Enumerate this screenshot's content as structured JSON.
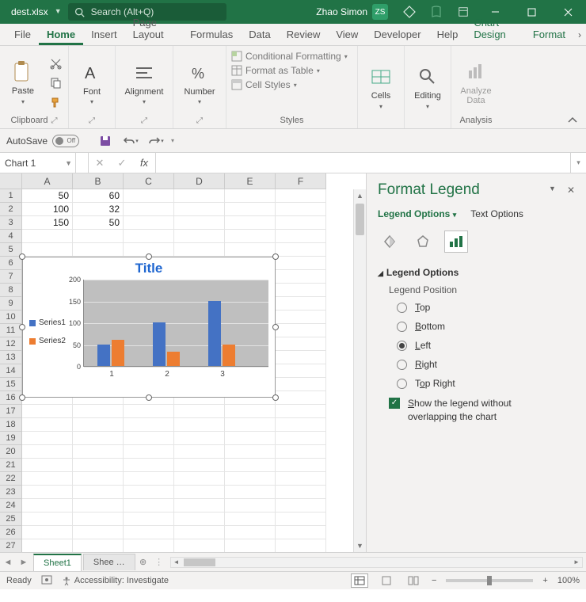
{
  "titlebar": {
    "filename": "dest.xlsx",
    "search_placeholder": "Search (Alt+Q)",
    "user_name": "Zhao Simon",
    "user_initials": "ZS"
  },
  "tabs": [
    "File",
    "Home",
    "Insert",
    "Page Layout",
    "Formulas",
    "Data",
    "Review",
    "View",
    "Developer",
    "Help",
    "Chart Design",
    "Format"
  ],
  "active_tab": "Home",
  "ribbon": {
    "clipboard": {
      "label": "Clipboard",
      "paste": "Paste"
    },
    "font": {
      "label": "Font"
    },
    "alignment": {
      "label": "Alignment"
    },
    "number": {
      "label": "Number"
    },
    "styles": {
      "label": "Styles",
      "cond": "Conditional Formatting",
      "table": "Format as Table",
      "cell": "Cell Styles"
    },
    "cells": {
      "label": "Cells"
    },
    "editing": {
      "label": "Editing"
    },
    "analysis": {
      "label": "Analysis",
      "analyze": "Analyze Data"
    }
  },
  "qat": {
    "autosave": "AutoSave",
    "off": "Off"
  },
  "namebox": "Chart 1",
  "columns": [
    "A",
    "B",
    "C",
    "D",
    "E",
    "F"
  ],
  "rows": 27,
  "cells": {
    "A1": "50",
    "B1": "60",
    "A2": "100",
    "B2": "32",
    "A3": "150",
    "B3": "50"
  },
  "chart_data": {
    "type": "bar",
    "title": "Title",
    "categories": [
      "1",
      "2",
      "3"
    ],
    "series": [
      {
        "name": "Series1",
        "values": [
          50,
          100,
          150
        ],
        "color": "#4472C4"
      },
      {
        "name": "Series2",
        "values": [
          60,
          32,
          50
        ],
        "color": "#ED7D31"
      }
    ],
    "ylim": [
      0,
      200
    ],
    "yticks": [
      0,
      50,
      100,
      150,
      200
    ],
    "legend_position": "left"
  },
  "pane": {
    "title": "Format Legend",
    "legend_options": "Legend Options",
    "text_options": "Text Options",
    "section": "Legend Options",
    "position_label": "Legend Position",
    "positions": [
      "Top",
      "Bottom",
      "Left",
      "Right",
      "Top Right"
    ],
    "selected_position": "Left",
    "show_no_overlap": "Show the legend without overlapping the chart",
    "show_no_overlap_checked": true
  },
  "sheets": {
    "active": "Sheet1",
    "other": "Shee …"
  },
  "status": {
    "ready": "Ready",
    "acc": "Accessibility: Investigate",
    "zoom": "100%"
  }
}
